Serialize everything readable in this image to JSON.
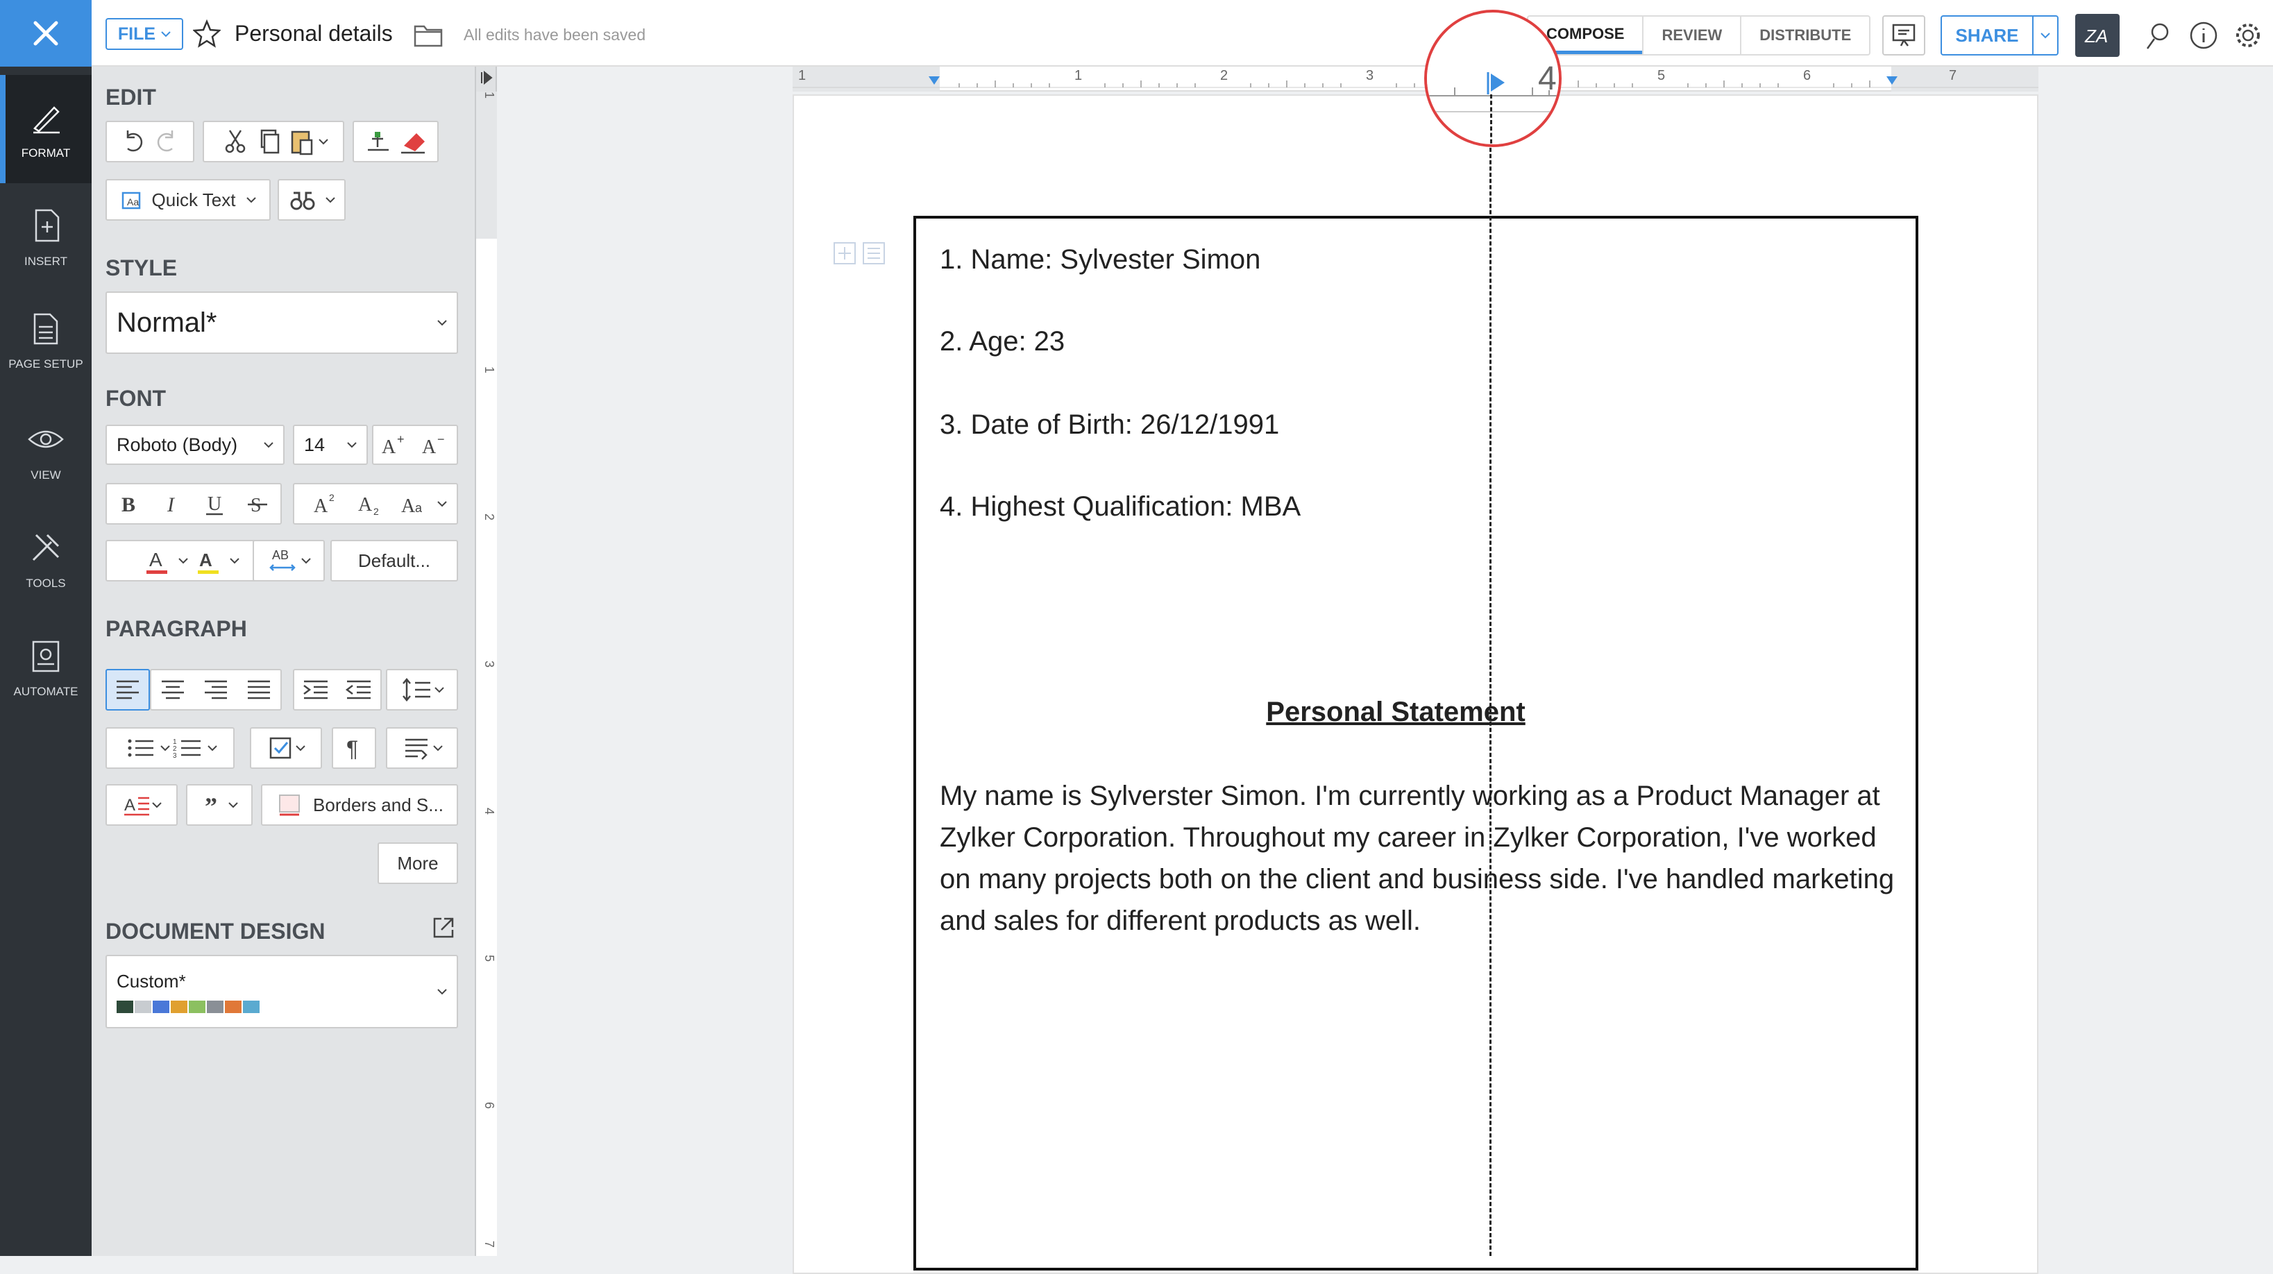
{
  "topbar": {
    "file_label": "FILE",
    "doc_title": "Personal details",
    "save_status": "All edits have been saved",
    "tabs": [
      {
        "label": "COMPOSE",
        "active": true
      },
      {
        "label": "REVIEW",
        "active": false
      },
      {
        "label": "DISTRIBUTE",
        "active": false
      }
    ],
    "compose_visible_label": "OMPOSE",
    "share_label": "SHARE",
    "za_label": "ZA",
    "accent_color": "#3d8fe0"
  },
  "leftnav": {
    "items": [
      {
        "label": "FORMAT",
        "icon": "format-icon",
        "active": true
      },
      {
        "label": "INSERT",
        "icon": "insert-icon",
        "active": false
      },
      {
        "label": "PAGE SETUP",
        "icon": "page-setup-icon",
        "active": false
      },
      {
        "label": "VIEW",
        "icon": "view-icon",
        "active": false
      },
      {
        "label": "TOOLS",
        "icon": "tools-icon",
        "active": false
      },
      {
        "label": "AUTOMATE",
        "icon": "automate-icon",
        "active": false
      }
    ]
  },
  "panel": {
    "edit_heading": "EDIT",
    "quick_text": "Quick Text",
    "style_heading": "STYLE",
    "style_value": "Normal",
    "style_modified": "*",
    "font_heading": "FONT",
    "font_family": "Roboto (Body)",
    "font_size": "14",
    "default_label": "Default...",
    "paragraph_heading": "PARAGRAPH",
    "borders_label": "Borders and S...",
    "more_label": "More",
    "doc_design_heading": "DOCUMENT DESIGN",
    "doc_design_value": "Custom*",
    "design_colors": [
      "#2e4a3a",
      "#c8ccd0",
      "#4a78d8",
      "#e0a030",
      "#8cc060",
      "#8a8f96",
      "#e07838",
      "#5aaad0"
    ]
  },
  "ruler": {
    "h_numbers": [
      "1",
      "1",
      "2",
      "3",
      "4",
      "5",
      "6",
      "7"
    ],
    "v_numbers": [
      "1",
      "1",
      "2",
      "3",
      "4",
      "5",
      "6",
      "7"
    ],
    "zoom_number": "4"
  },
  "document": {
    "lines": [
      "1. Name: Sylvester Simon",
      "2. Age: 23",
      "3. Date of Birth: 26/12/1991",
      "4. Highest Qualification: MBA"
    ],
    "heading": "Personal Statement",
    "paragraph": "My name is Sylverster Simon. I'm currently working as a Product Manager at Zylker Corporation. Throughout my career in Zylker Corporation, I've worked on many projects both on the client and business side. I've handled marketing and sales for different products as well."
  }
}
